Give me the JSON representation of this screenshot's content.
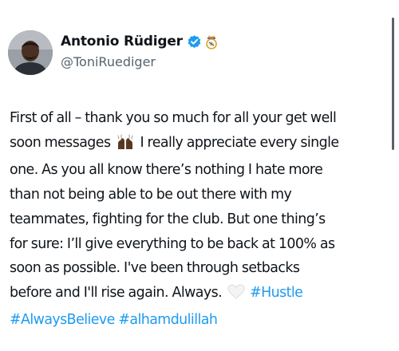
{
  "author": {
    "display_name": "Antonio Rüdiger",
    "handle": "@ToniRuediger",
    "verified": true,
    "colors": {
      "verified_badge": "#1d9bf0",
      "handle": "#536471"
    }
  },
  "tweet": {
    "lines": [
      "First of all – thank you so much for all your get well",
      "soon messages",
      "I really appreciate every single",
      "one. As you all know there’s nothing I hate more",
      "than not being able to be out there with my",
      "teammates, fighting for the club. But one thing’s",
      "for sure: I’ll give everything to be back at 100% as",
      "soon as possible. I've been through setbacks",
      "before and I'll rise again. Always.",
      "#Hustle",
      "#AlwaysBelieve",
      "#alhamdulillah"
    ],
    "emojis": {
      "praise_hands": "raising-hands-icon",
      "white_heart": "white-heart-icon"
    },
    "colors": {
      "text": "#0f1419",
      "hashtag": "#1d9bf0"
    }
  }
}
